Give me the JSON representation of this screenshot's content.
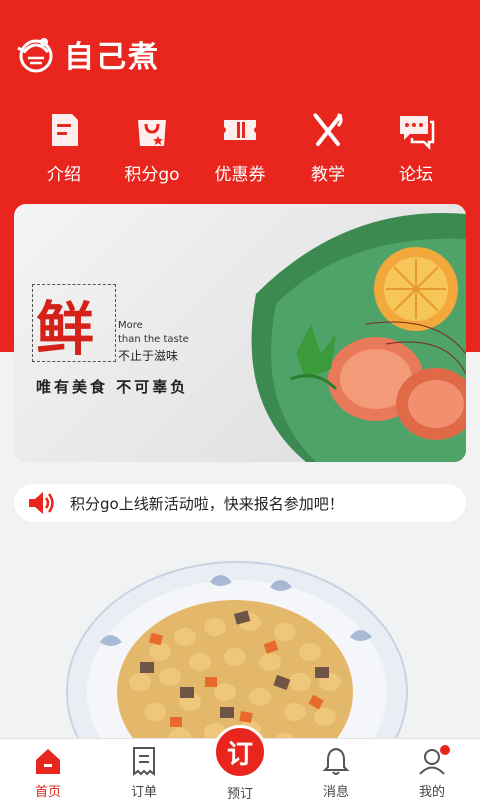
{
  "app": {
    "name": "自己煮",
    "brand_color": "#e8261e"
  },
  "quick_nav": [
    {
      "label": "介绍",
      "icon": "document-icon"
    },
    {
      "label": "积分go",
      "icon": "shopping-bag-icon"
    },
    {
      "label": "优惠券",
      "icon": "coupon-icon"
    },
    {
      "label": "教学",
      "icon": "fork-knife-icon"
    },
    {
      "label": "论坛",
      "icon": "chat-bubble-icon"
    }
  ],
  "banner": {
    "fresh_char": "鲜",
    "en_line1": "More",
    "en_line2": "than the taste",
    "cn_line": "不止于滋味",
    "slogan": "唯有美食  不可辜负"
  },
  "notice": {
    "text": "积分go上线新活动啦，快来报名参加吧！",
    "icon": "speaker-icon"
  },
  "tabbar": {
    "items": [
      {
        "label": "首页",
        "icon": "home-icon",
        "active": true
      },
      {
        "label": "订单",
        "icon": "receipt-icon",
        "active": false
      },
      {
        "label": "预订",
        "icon": "order-circle",
        "center_text": "订",
        "active": false
      },
      {
        "label": "消息",
        "icon": "bell-icon",
        "active": false
      },
      {
        "label": "我的",
        "icon": "user-icon",
        "active": false,
        "badge": true
      }
    ]
  }
}
